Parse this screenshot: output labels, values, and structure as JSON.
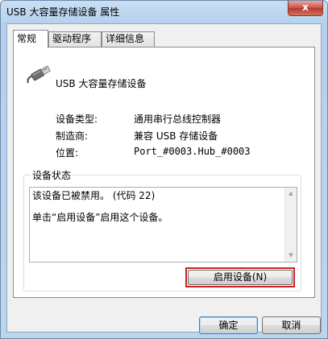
{
  "window": {
    "title": "USB 大容量存储设备 属性",
    "close_label": "x"
  },
  "tabs": [
    {
      "label": "常规",
      "active": true
    },
    {
      "label": "驱动程序",
      "active": false
    },
    {
      "label": "详细信息",
      "active": false
    }
  ],
  "general": {
    "device_name": "USB 大容量存储设备",
    "properties": [
      {
        "label": "设备类型:",
        "value": "通用串行总线控制器"
      },
      {
        "label": "制造商:",
        "value": "兼容 USB 存储设备"
      },
      {
        "label": "位置:",
        "value": "Port_#0003.Hub_#0003"
      }
    ],
    "status_group_title": "设备状态",
    "status_lines": [
      "该设备已被禁用。 (代码 22)",
      "单击“启用设备”启用这个设备。"
    ],
    "enable_button_label": "启用设备(N)"
  },
  "footer": {
    "ok_label": "确定",
    "cancel_label": "取消"
  },
  "colors": {
    "highlight_border": "#d22020",
    "title_gradient_top": "#c9dff4"
  },
  "icons": {
    "device": "usb-plug-icon",
    "close": "close-icon"
  }
}
